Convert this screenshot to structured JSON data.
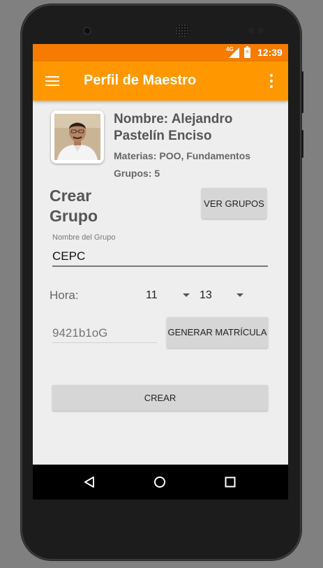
{
  "status_bar": {
    "network": "4G",
    "battery_glyph": "⚡",
    "time": "12:39"
  },
  "app_bar": {
    "title": "Perfil de Maestro",
    "menu_icon": "hamburger-menu-icon",
    "overflow_icon": "more-vert-icon"
  },
  "profile": {
    "name": "Nombre: Alejandro Pastelín Enciso",
    "subjects": "Materias: POO, Fundamentos",
    "groups": "Grupos: 5"
  },
  "create_group": {
    "heading": "Crear Grupo",
    "view_groups_button": "VER GRUPOS",
    "group_name_label": "Nombre del Grupo",
    "group_name_value": "CEPC",
    "hora_label": "Hora:",
    "hora_start": "11",
    "hora_end": "13",
    "matricula_placeholder": "9421b1oG",
    "generate_button": "GENERAR MATRÍCULA",
    "create_button": "CREAR"
  },
  "nav_bar": {
    "icons": [
      "back-icon",
      "home-icon",
      "recents-icon"
    ]
  },
  "colors": {
    "status_bar": "#f57c00",
    "app_bar": "#ff9800",
    "background": "#eeeeee",
    "button": "#d6d6d6"
  }
}
